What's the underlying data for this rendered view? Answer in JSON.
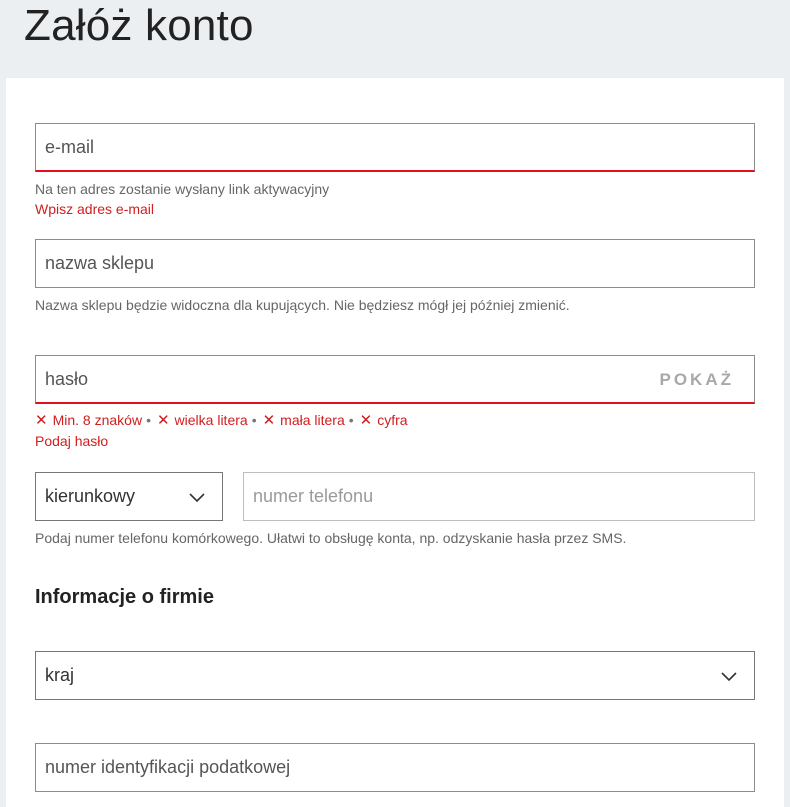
{
  "page": {
    "title": "Załóż konto"
  },
  "email": {
    "placeholder": "e-mail",
    "hint": "Na ten adres zostanie wysłany link aktywacyjny",
    "error": "Wpisz adres e-mail"
  },
  "shop_name": {
    "placeholder": "nazwa sklepu",
    "hint": "Nazwa sklepu będzie widoczna dla kupujących. Nie będziesz mógł jej później zmienić."
  },
  "password": {
    "placeholder": "hasło",
    "show_label": "POKAŻ",
    "rules": [
      "Min. 8 znaków",
      "wielka litera",
      "mała litera",
      "cyfra"
    ],
    "rule_mark": "✕",
    "separator": "•",
    "error": "Podaj hasło"
  },
  "phone": {
    "prefix_value": "kierunkowy",
    "number_placeholder": "numer telefonu",
    "hint": "Podaj numer telefonu komórkowego. Ułatwi to obsługę konta, np. odzyskanie hasła przez SMS."
  },
  "company": {
    "heading": "Informacje o firmie",
    "country_value": "kraj",
    "tax_id_placeholder": "numer identyfikacji podatkowej"
  },
  "colors": {
    "error": "#e20f1f",
    "background": "#eceff2",
    "card": "#ffffff"
  }
}
